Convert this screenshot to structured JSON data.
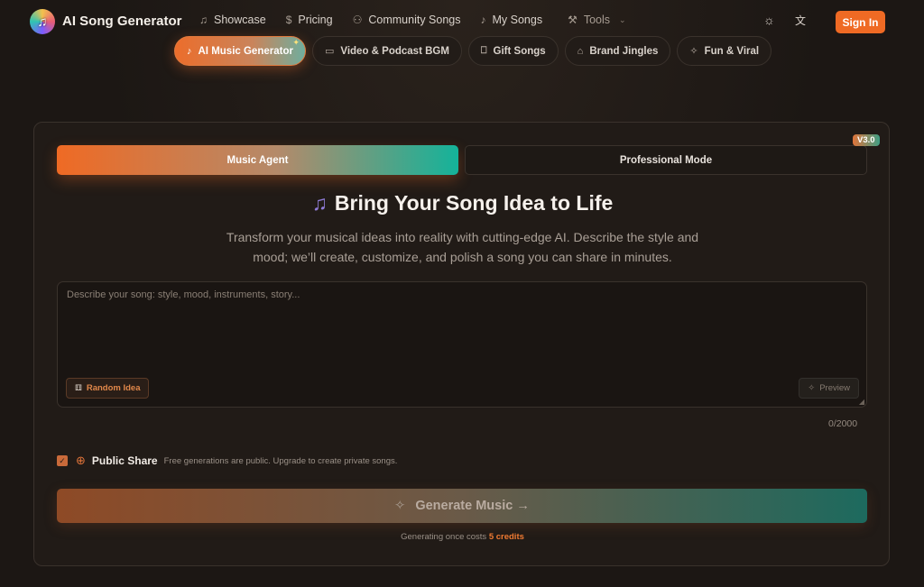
{
  "header": {
    "brand": "AI Song Generator",
    "logo_glyph": "♫",
    "nav": [
      {
        "label": "Showcase",
        "icon": "music-note-icon",
        "glyph": "♫"
      },
      {
        "label": "Pricing",
        "icon": "dollar-icon",
        "glyph": "$"
      },
      {
        "label": "Community Songs",
        "icon": "users-icon",
        "glyph": "⚇"
      },
      {
        "label": "My Songs",
        "icon": "music-icon",
        "glyph": "♪"
      },
      {
        "label": "Tools",
        "icon": "wrench-icon",
        "glyph": "⚒"
      }
    ],
    "theme_glyph": "☼",
    "lang_glyph": "文",
    "signin_label": "Sign In"
  },
  "pills": [
    {
      "label": "AI Music Generator",
      "glyph": "♪"
    },
    {
      "label": "Video & Podcast BGM",
      "glyph": "▭"
    },
    {
      "label": "Gift Songs",
      "glyph": "⎕"
    },
    {
      "label": "Brand Jingles",
      "glyph": "⌂"
    },
    {
      "label": "Fun & Viral",
      "glyph": "✧"
    }
  ],
  "card": {
    "tabs": {
      "agent": "Music Agent",
      "pro": "Professional Mode"
    },
    "version": "V3.0",
    "title": "Bring Your Song Idea to Life",
    "title_glyph": "♫",
    "subtitle": "Transform your musical ideas into reality with cutting-edge AI. Describe the style and mood; we’ll create, customize, and polish a song you can share in minutes.",
    "textarea_placeholder": "Describe your song: style, mood, instruments, story...",
    "random_label": "Random Idea",
    "preview_label": "Preview",
    "counter": "0/2000",
    "share_label": "Public Share",
    "share_note": "Free generations are public. Upgrade to create private songs.",
    "generate_label": "Generate Music →",
    "cost_prefix": "Generating once costs",
    "cost_credits": "5 credits"
  },
  "colors": {
    "accent": "#ef6a24",
    "teal": "#14b39a",
    "background": "#1c1714"
  }
}
